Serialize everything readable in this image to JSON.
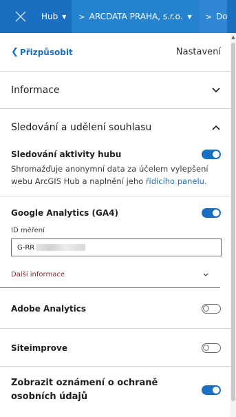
{
  "topbar": {
    "hub_label": "Hub",
    "crumbs": [
      {
        "label": "ARCDATA PRAHA, s.r.o."
      },
      {
        "label": "Do"
      }
    ],
    "bg_color": "#1a6fc0"
  },
  "subheader": {
    "back_label": "Přizpůsobit",
    "title": "Nastavení"
  },
  "sections": {
    "info": {
      "title": "Informace",
      "icon": "chevron-down-icon"
    },
    "tracking": {
      "title": "Sledování a udělení souhlasu",
      "icon": "chevron-up-icon"
    }
  },
  "hub_tracking": {
    "label": "Sledování aktivity hubu",
    "enabled": true,
    "desc_before": "Shromažďuje anonymní data za účelem vylepšení webu ArcGIS Hub a naplnění jeho ",
    "desc_link": "řídicího panelu",
    "desc_after": "."
  },
  "google_analytics": {
    "label": "Google Analytics (GA4)",
    "enabled": true,
    "field_label": "ID měření",
    "field_value": "G-RR",
    "more_label": "Další informace"
  },
  "adobe": {
    "label": "Adobe Analytics",
    "enabled": false
  },
  "siteimprove": {
    "label": "Siteimprove",
    "enabled": false
  },
  "privacy_notice": {
    "label": "Zobrazit oznámení o ochraně osobních údajů",
    "enabled": true
  }
}
